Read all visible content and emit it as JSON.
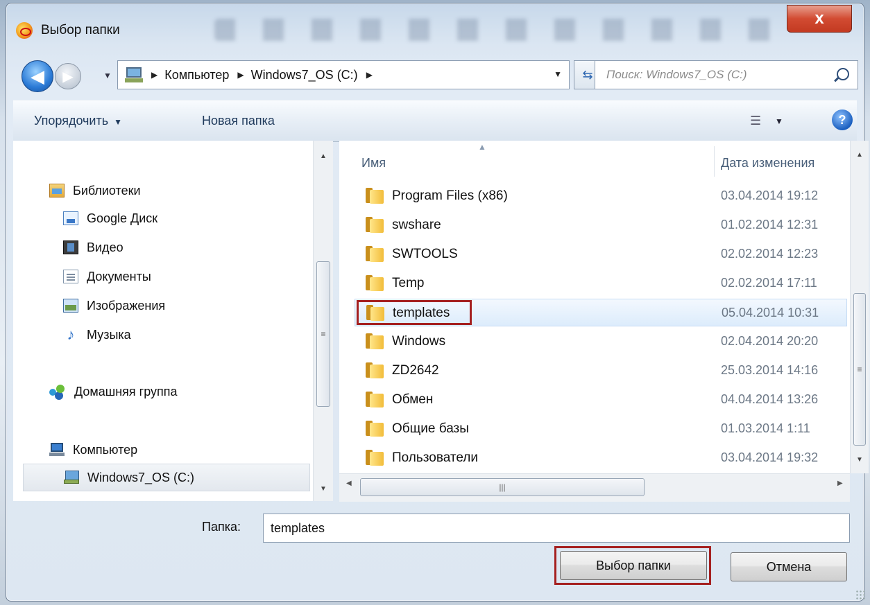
{
  "window": {
    "title": "Выбор папки",
    "close_label": "x"
  },
  "nav": {
    "back_glyph": "◀",
    "forward_glyph": "▶",
    "breadcrumbs": [
      "Компьютер",
      "Windows7_OS (C:)"
    ],
    "search_placeholder": "Поиск: Windows7_OS (C:)"
  },
  "toolbar": {
    "organize_label": "Упорядочить",
    "new_folder_label": "Новая папка"
  },
  "sidebar": {
    "items": [
      {
        "label": "Библиотеки",
        "icon": "library-icon"
      },
      {
        "label": "Google Диск",
        "icon": "document-icon"
      },
      {
        "label": "Видео",
        "icon": "video-icon"
      },
      {
        "label": "Документы",
        "icon": "document-icon"
      },
      {
        "label": "Изображения",
        "icon": "image-icon"
      },
      {
        "label": "Музыка",
        "icon": "music-icon"
      },
      {
        "label": "Домашняя группа",
        "icon": "homegroup-icon"
      },
      {
        "label": "Компьютер",
        "icon": "computer-icon"
      },
      {
        "label": "Windows7_OS (C:)",
        "icon": "drive-icon"
      }
    ]
  },
  "filelist": {
    "columns": {
      "name": "Имя",
      "date": "Дата изменения"
    },
    "rows": [
      {
        "name": "Program Files (x86)",
        "date": "03.04.2014 19:12"
      },
      {
        "name": "swshare",
        "date": "01.02.2014 12:31"
      },
      {
        "name": "SWTOOLS",
        "date": "02.02.2014 12:23"
      },
      {
        "name": "Temp",
        "date": "02.02.2014 17:11"
      },
      {
        "name": "templates",
        "date": "05.04.2014 10:31",
        "selected": true
      },
      {
        "name": "Windows",
        "date": "02.04.2014 20:20"
      },
      {
        "name": "ZD2642",
        "date": "25.03.2014 14:16"
      },
      {
        "name": "Обмен",
        "date": "04.04.2014 13:26"
      },
      {
        "name": "Общие базы",
        "date": "01.03.2014 1:11"
      },
      {
        "name": "Пользователи",
        "date": "03.04.2014 19:32"
      }
    ]
  },
  "footer": {
    "folder_label": "Папка:",
    "folder_value": "templates",
    "select_button": "Выбор папки",
    "cancel_button": "Отмена"
  },
  "colors": {
    "highlight": "#a52020",
    "selection": "#dcecfc"
  }
}
